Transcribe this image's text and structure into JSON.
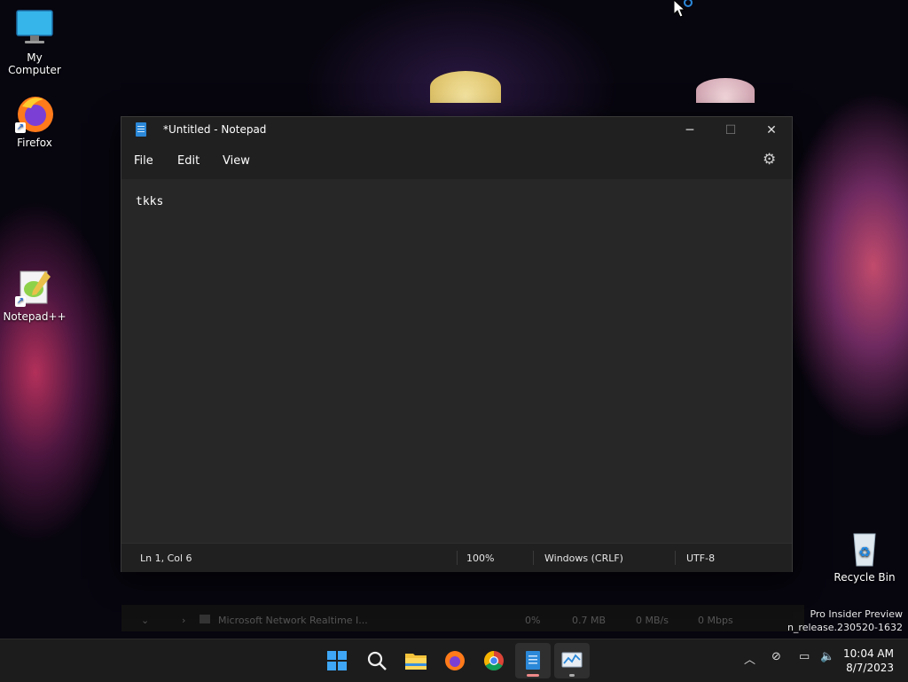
{
  "desktop": {
    "icons": [
      {
        "label": "My Computer"
      },
      {
        "label": "Firefox"
      },
      {
        "label": "Notepad++"
      },
      {
        "label": "Recycle Bin"
      }
    ],
    "watermark": {
      "line1": "Pro Insider Preview",
      "line2": "n_release.230520-1632"
    }
  },
  "notepad": {
    "title": "*Untitled - Notepad",
    "menu": {
      "file": "File",
      "edit": "Edit",
      "view": "View"
    },
    "content": "tkks",
    "status": {
      "position": "Ln 1, Col 6",
      "zoom": "100%",
      "line_ending": "Windows (CRLF)",
      "encoding": "UTF-8"
    }
  },
  "ghost_row": {
    "name": "Microsoft Network Realtime I...",
    "cpu": "0%",
    "memory": "0.7 MB",
    "disk": "0 MB/s",
    "network": "0 Mbps"
  },
  "taskbar": {
    "apps": [
      "start-icon",
      "search-icon",
      "file-explorer-icon",
      "firefox-icon",
      "chrome-icon",
      "notepad-icon",
      "task-manager-icon"
    ],
    "clock": {
      "time": "10:04 AM",
      "date": "8/7/2023"
    }
  },
  "colors": {
    "accent": "#2b88d8",
    "window_bg": "#272727",
    "titlebar_bg": "#202020"
  }
}
